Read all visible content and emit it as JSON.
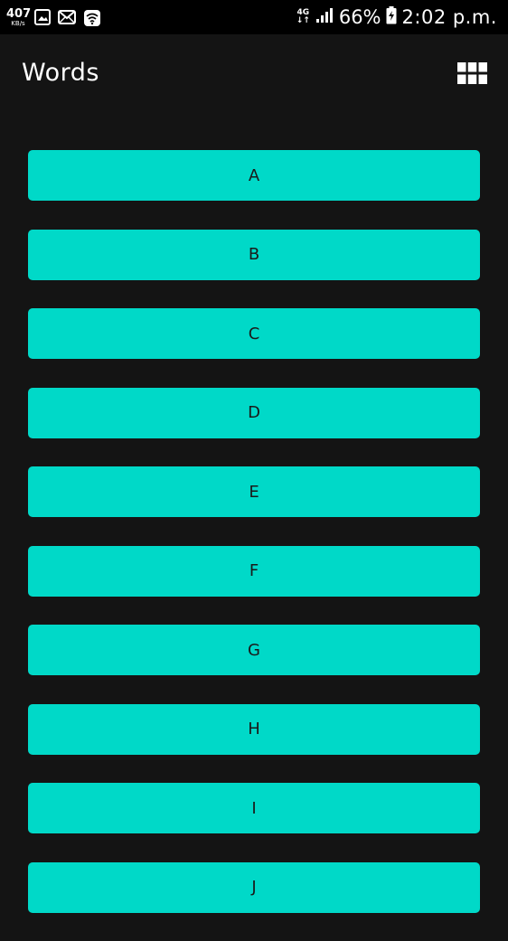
{
  "status_bar": {
    "speed_value": "407",
    "speed_unit": "KB/s",
    "network_type": "4G",
    "battery": "66%",
    "time": "2:02 p.m."
  },
  "app_bar": {
    "title": "Words",
    "view_toggle_icon": "grid-view-icon"
  },
  "colors": {
    "background": "#141414",
    "status_bar": "#000000",
    "button": "#00d9c8",
    "button_text": "#1a1a1a",
    "title_text": "#ffffff"
  },
  "letters": [
    "A",
    "B",
    "C",
    "D",
    "E",
    "F",
    "G",
    "H",
    "I",
    "J"
  ]
}
